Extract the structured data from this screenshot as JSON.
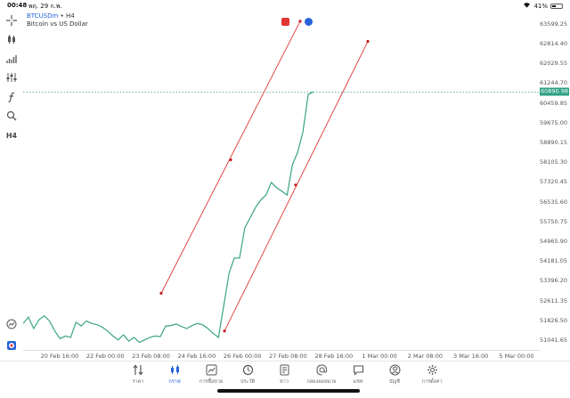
{
  "status_bar": {
    "time": "00:48",
    "date": "พฤ. 29 ก.พ.",
    "battery": "41%",
    "battery_level": 0.41
  },
  "chart": {
    "symbol": "BTCUSDm",
    "timeframe": "H4",
    "description": "Bitcoin vs US Dollar",
    "current_price": "60890.98",
    "line_color": "#3aa57a",
    "trend_line_color": "#e03535",
    "price_line_color": "#2c9f82"
  },
  "toolbar": {
    "timeframe_label": "H4",
    "icons": [
      "crosshair-icon",
      "candlestick-icon",
      "indicators-icon",
      "settings-sliders-icon",
      "function-icon",
      "objects-icon",
      "h4-timeframe"
    ]
  },
  "chart_data": {
    "type": "line",
    "x_labels": [
      "20 Feb 16:00",
      "22 Feb 00:00",
      "23 Feb 08:00",
      "24 Feb 16:00",
      "26 Feb 00:00",
      "27 Feb 08:00",
      "28 Feb 16:00",
      "1 Mar 00:00",
      "2 Mar 08:00",
      "3 Mar 16:00",
      "5 Mar 00:00"
    ],
    "y_labels": [
      "63599.25",
      "62814.40",
      "62029.55",
      "61244.70",
      "60459.85",
      "59675.00",
      "58890.15",
      "58105.30",
      "57320.45",
      "56535.60",
      "55750.75",
      "54965.90",
      "54181.05",
      "53396.20",
      "52611.35",
      "51826.50",
      "51041.65"
    ],
    "ylim": [
      50650,
      64050
    ],
    "series": [
      {
        "values": [
          51700,
          51950,
          51500,
          51850,
          52000,
          51800,
          51400,
          51100,
          51200,
          51150,
          51750,
          51600,
          51800,
          51700,
          51650,
          51550,
          51400,
          51200,
          51050,
          51250,
          51000,
          51150,
          50950,
          51050,
          51150,
          51200,
          51180,
          51600,
          51620,
          51680,
          51580,
          51500,
          51620,
          51700,
          51650,
          51500,
          51300,
          51150,
          52400,
          53700,
          54300,
          54300,
          55500,
          55900,
          56300,
          56600,
          56800,
          57300,
          57100,
          56950,
          56800,
          58000,
          58500,
          59300,
          60800,
          60890.98
        ]
      }
    ],
    "trend_lines": [
      {
        "points": [
          [
            52900,
            "23 Feb 08:00"
          ],
          [
            58200,
            null
          ],
          [
            63700,
            null
          ]
        ]
      },
      {
        "points": [
          [
            51400,
            null
          ],
          [
            57200,
            null
          ],
          [
            62900,
            null
          ]
        ]
      }
    ],
    "current_price": 60890.98
  },
  "bottom_nav": [
    {
      "label": "ราคา",
      "icon": "quotes-icon",
      "active": false
    },
    {
      "label": "กราฟ",
      "icon": "chart-icon",
      "active": true
    },
    {
      "label": "การซื้อขาย",
      "icon": "trade-icon",
      "active": false
    },
    {
      "label": "ประวัติ",
      "icon": "history-icon",
      "active": false
    },
    {
      "label": "ข่าว",
      "icon": "news-icon",
      "active": false
    },
    {
      "label": "กล่องจดหมาย",
      "icon": "mailbox-icon",
      "active": false
    },
    {
      "label": "แชท",
      "icon": "chat-icon",
      "active": false
    },
    {
      "label": "บัญชี",
      "icon": "account-icon",
      "active": false
    },
    {
      "label": "การตั้งค่า",
      "icon": "settings-icon",
      "active": false
    }
  ]
}
